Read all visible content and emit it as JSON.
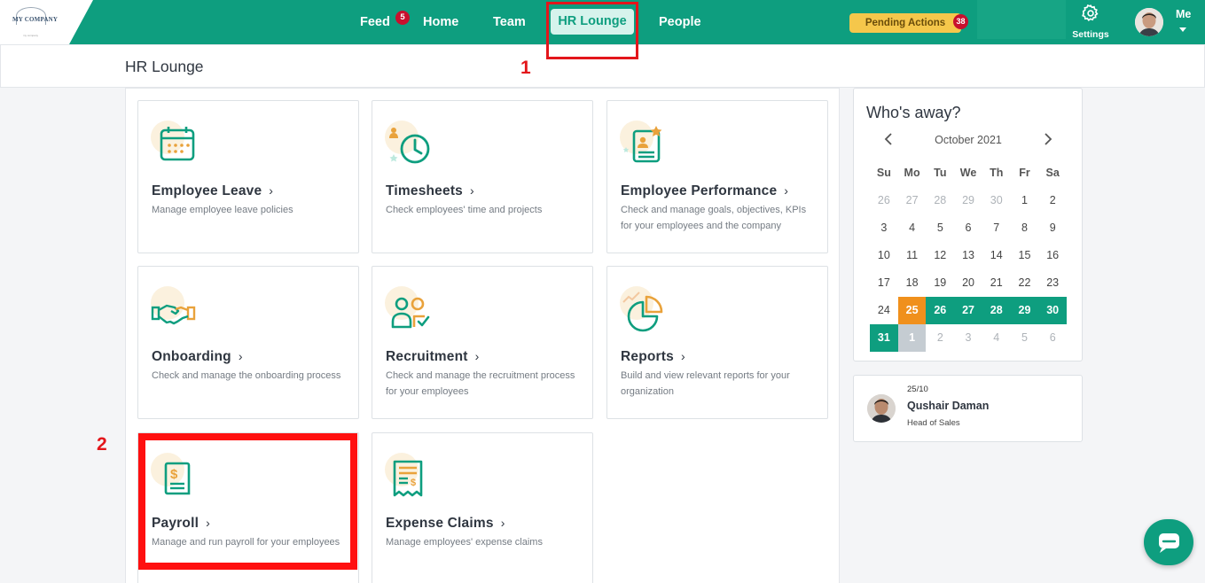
{
  "brand": {
    "logo_text": "MY COMPANY",
    "logo_sub": "my company"
  },
  "nav": {
    "feed": "Feed",
    "feed_badge": "5",
    "home": "Home",
    "team": "Team",
    "hr_lounge": "HR Lounge",
    "people": "People"
  },
  "header_right": {
    "pending_actions": "Pending Actions",
    "pending_badge": "38",
    "settings": "Settings",
    "me": "Me"
  },
  "page": {
    "title": "HR Lounge"
  },
  "annotations": {
    "one": "1",
    "two": "2"
  },
  "cards": [
    {
      "title": "Employee Leave",
      "desc": "Manage employee leave policies",
      "icon": "calendar-icon"
    },
    {
      "title": "Timesheets",
      "desc": "Check employees' time and projects",
      "icon": "clock-icon"
    },
    {
      "title": "Employee Performance",
      "desc": "Check and manage goals, objectives, KPIs for your employees and the company",
      "icon": "performance-icon"
    },
    {
      "title": "Onboarding",
      "desc": "Check and manage the onboarding process",
      "icon": "handshake-icon"
    },
    {
      "title": "Recruitment",
      "desc": "Check and manage the recruitment process for your employees",
      "icon": "recruitment-icon"
    },
    {
      "title": "Reports",
      "desc": "Build and view relevant reports for your organization",
      "icon": "pie-chart-icon"
    },
    {
      "title": "Payroll",
      "desc": "Manage and run payroll for your employees",
      "icon": "payroll-icon"
    },
    {
      "title": "Expense Claims",
      "desc": "Manage employees' expense claims",
      "icon": "receipt-icon"
    }
  ],
  "away": {
    "title": "Who's away?",
    "month": "October 2021",
    "weekdays": [
      "Su",
      "Mo",
      "Tu",
      "We",
      "Th",
      "Fr",
      "Sa"
    ],
    "weeks": [
      [
        [
          "26",
          "muted"
        ],
        [
          "27",
          "muted"
        ],
        [
          "28",
          "muted"
        ],
        [
          "29",
          "muted"
        ],
        [
          "30",
          "muted"
        ],
        [
          "1",
          ""
        ],
        [
          "2",
          ""
        ]
      ],
      [
        [
          "3",
          ""
        ],
        [
          "4",
          ""
        ],
        [
          "5",
          ""
        ],
        [
          "6",
          ""
        ],
        [
          "7",
          ""
        ],
        [
          "8",
          ""
        ],
        [
          "9",
          ""
        ]
      ],
      [
        [
          "10",
          ""
        ],
        [
          "11",
          ""
        ],
        [
          "12",
          ""
        ],
        [
          "13",
          ""
        ],
        [
          "14",
          ""
        ],
        [
          "15",
          ""
        ],
        [
          "16",
          ""
        ]
      ],
      [
        [
          "17",
          ""
        ],
        [
          "18",
          ""
        ],
        [
          "19",
          ""
        ],
        [
          "20",
          ""
        ],
        [
          "21",
          ""
        ],
        [
          "22",
          ""
        ],
        [
          "23",
          ""
        ]
      ],
      [
        [
          "24",
          ""
        ],
        [
          "25",
          "orange"
        ],
        [
          "26",
          "green"
        ],
        [
          "27",
          "green"
        ],
        [
          "28",
          "green"
        ],
        [
          "29",
          "green"
        ],
        [
          "30",
          "green"
        ]
      ],
      [
        [
          "31",
          "green"
        ],
        [
          "1",
          "grey"
        ],
        [
          "2",
          "muted"
        ],
        [
          "3",
          "muted"
        ],
        [
          "4",
          "muted"
        ],
        [
          "5",
          "muted"
        ],
        [
          "6",
          "muted"
        ]
      ]
    ]
  },
  "person": {
    "date": "25/10",
    "name": "Qushair Daman",
    "role": "Head of Sales"
  },
  "colors": {
    "brand": "#0e9e7f",
    "accent_orange": "#f0901c",
    "badge_red": "#c8102e",
    "annotation_red": "#e3161b"
  }
}
